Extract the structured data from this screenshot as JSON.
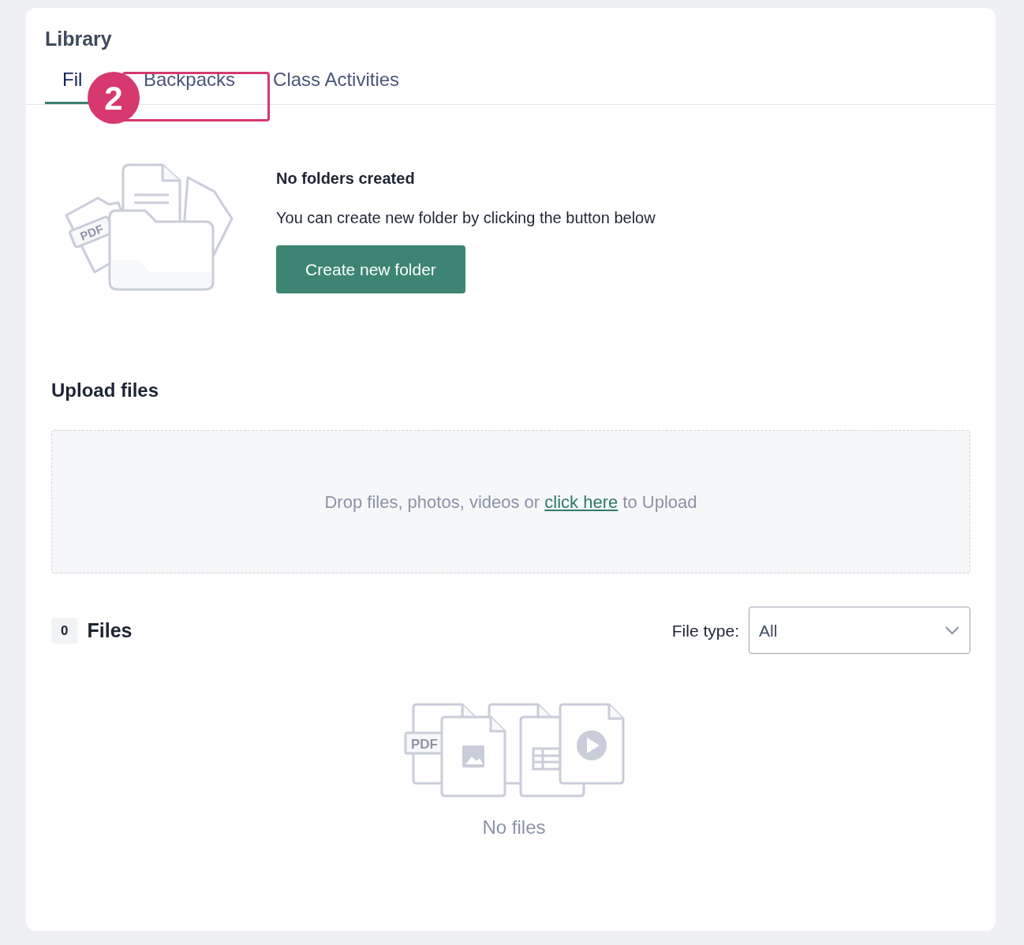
{
  "title": "Library",
  "tabs": [
    {
      "label": "Fil",
      "selected": true
    },
    {
      "label": "Backpacks",
      "selected": false
    },
    {
      "label": "Class Activities",
      "selected": false
    }
  ],
  "annotation": {
    "number": "2"
  },
  "folders": {
    "illustration_label": "PDF",
    "heading": "No folders created",
    "message": "You can create new folder by clicking the button below",
    "button": "Create new folder"
  },
  "upload": {
    "heading": "Upload files",
    "before_link": "Drop files, photos, videos or",
    "link": "click here",
    "after_link": "to Upload"
  },
  "files": {
    "count": "0",
    "heading": "Files",
    "filter_label": "File type:",
    "filter_value": "All",
    "illustration_label": "PDF",
    "empty_text": "No files"
  }
}
